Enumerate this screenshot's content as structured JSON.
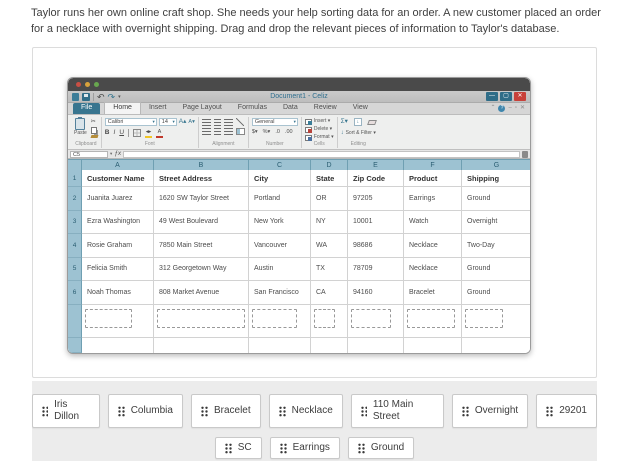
{
  "instructions": "Taylor runs her own online craft shop. She needs your help sorting data for an order. A new customer placed an order for a necklace with overnight shipping. Drag and drop the relevant pieces of information to Taylor's database.",
  "window": {
    "title": "Document1 - Celiz",
    "controls": {
      "minimize": "—",
      "maximize": "▢",
      "close": "✕"
    },
    "tabs": [
      "File",
      "Home",
      "Insert",
      "Page Layout",
      "Formulas",
      "Data",
      "Review",
      "View"
    ],
    "active_tab": "Home",
    "ribbon": {
      "groups": [
        "Clipboard",
        "Font",
        "Alignment",
        "Number",
        "Cells",
        "Editing"
      ],
      "paste_label": "Paste",
      "font_name": "Calibri",
      "font_size": "14",
      "number_format": "General",
      "cells_buttons": [
        "Insert",
        "Delete",
        "Format"
      ],
      "autosum": "Σ",
      "sort_filter": "Sort & Filter"
    },
    "formula_bar": {
      "name_box": "C5",
      "fx": "ƒx",
      "value": ""
    }
  },
  "spreadsheet": {
    "column_letters": [
      "A",
      "B",
      "C",
      "D",
      "E",
      "F",
      "G"
    ],
    "row_numbers": [
      "1",
      "2",
      "3",
      "4",
      "5",
      "6"
    ],
    "headers": [
      "Customer Name",
      "Street Address",
      "City",
      "State",
      "Zip Code",
      "Product",
      "Shipping"
    ],
    "rows": [
      [
        "Juanita Juarez",
        "1620 SW Taylor Street",
        "Portland",
        "OR",
        "97205",
        "Earrings",
        "Ground"
      ],
      [
        "Ezra Washington",
        "49 West Boulevard",
        "New York",
        "NY",
        "10001",
        "Watch",
        "Overnight"
      ],
      [
        "Rosie Graham",
        "7850 Main Street",
        "Vancouver",
        "WA",
        "98686",
        "Necklace",
        "Two-Day"
      ],
      [
        "Felicia Smith",
        "312 Georgetown Way",
        "Austin",
        "TX",
        "78709",
        "Necklace",
        "Ground"
      ],
      [
        "Noah Thomas",
        "808 Market Avenue",
        "San Francisco",
        "CA",
        "94160",
        "Bracelet",
        "Ground"
      ]
    ],
    "dropzones": {
      "count": 7
    }
  },
  "word_bank": {
    "row1": [
      "Iris Dillon",
      "Columbia",
      "Bracelet",
      "Necklace",
      "110 Main Street",
      "Overnight",
      "29201"
    ],
    "row2": [
      "SC",
      "Earrings",
      "Ground"
    ]
  },
  "colors": {
    "accent_teal": "#38768f",
    "titlebar": "#4a4a4a",
    "close_red": "#c8413a",
    "header_blue": "#9dc2d2",
    "header_text": "#2b5e72",
    "chip_panel": "#ececec",
    "fill_yellow": "#f2c524",
    "font_red": "#c0392b"
  }
}
